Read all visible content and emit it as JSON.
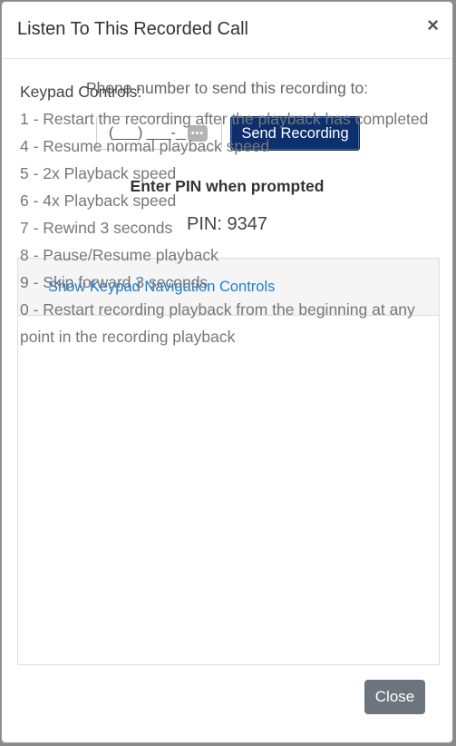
{
  "modal": {
    "title": "Listen To This Recorded Call",
    "close_symbol": "×"
  },
  "phone": {
    "prompt": "Phone number to send this recording to:",
    "value": "(___) ___-____",
    "autofill_icon": "autofill-icon",
    "send_label": "Send Recording"
  },
  "pin": {
    "instruction": "Enter PIN when prompted",
    "display": "PIN: 9347"
  },
  "keypad": {
    "toggle_label": "Show Keypad Navigation Controls",
    "title": "Keypad Controls:",
    "controls": [
      "1 - Restart the recording after the playback has completed",
      "4 - Resume normal playback speed",
      "5 - 2x Playback speed",
      "6 - 4x Playback speed",
      "7 - Rewind 3 seconds",
      "8 - Pause/Resume playback",
      "9 - Skip forward 3 seconds",
      "0 - Restart recording playback from the beginning at any point in the recording playback"
    ]
  },
  "footer": {
    "close_label": "Close"
  },
  "colors": {
    "primary_button": "#0d2f6e",
    "secondary_button": "#6c757d",
    "link": "#1a7fd4"
  }
}
